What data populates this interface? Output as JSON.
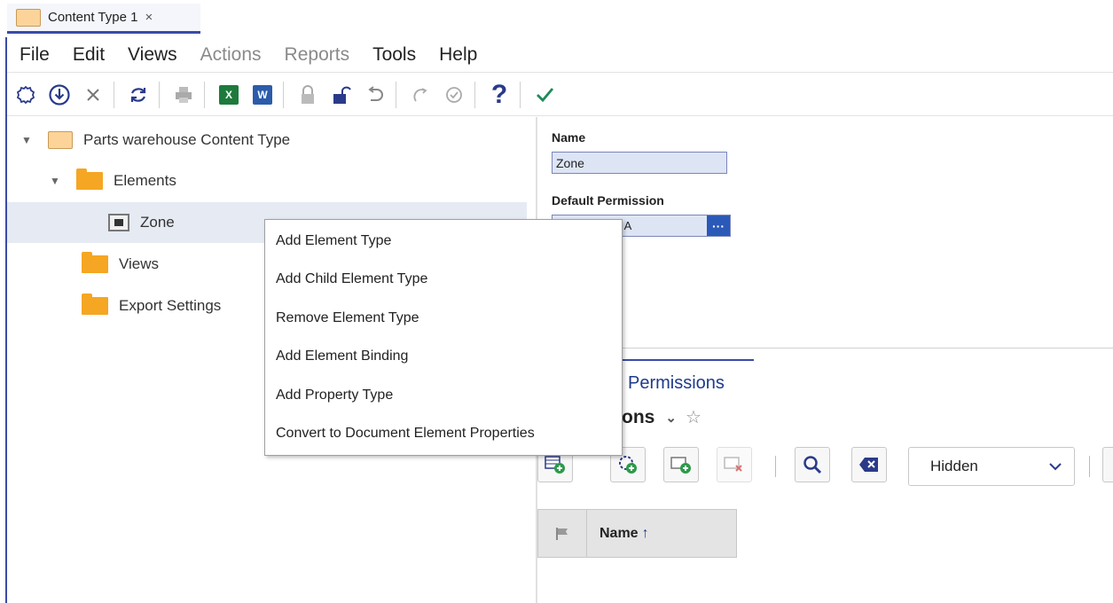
{
  "tab": {
    "title": "Content Type 1",
    "close": "×"
  },
  "menu": [
    {
      "label": "File",
      "enabled": true
    },
    {
      "label": "Edit",
      "enabled": true
    },
    {
      "label": "Views",
      "enabled": true
    },
    {
      "label": "Actions",
      "enabled": false
    },
    {
      "label": "Reports",
      "enabled": false
    },
    {
      "label": "Tools",
      "enabled": true
    },
    {
      "label": "Help",
      "enabled": true
    }
  ],
  "toolbar": {
    "help": "?",
    "excel": "X",
    "word": "W"
  },
  "tree": {
    "root": "Parts warehouse Content Type",
    "elements": "Elements",
    "zone": "Zone",
    "views": "Views",
    "export_settings": "Export Settings"
  },
  "properties": {
    "name_label": "Name",
    "name_value": "Zone",
    "permission_label": "Default Permission",
    "permission_value": "ment Default A",
    "permission_more": "···"
  },
  "lower": {
    "tab": "Permissions",
    "grid_title": "issions",
    "visibility_select": "Hidden",
    "column_name": "Name",
    "sort_arrow": "↑"
  },
  "context_menu": [
    "Add Element Type",
    "Add Child Element Type",
    "Remove Element Type",
    "Add Element Binding",
    "Add Property Type",
    "Convert to Document Element Properties"
  ],
  "colors": {
    "accent": "#3b4aa8",
    "folder": "#f5a623",
    "selection": "#e5eaf3"
  }
}
